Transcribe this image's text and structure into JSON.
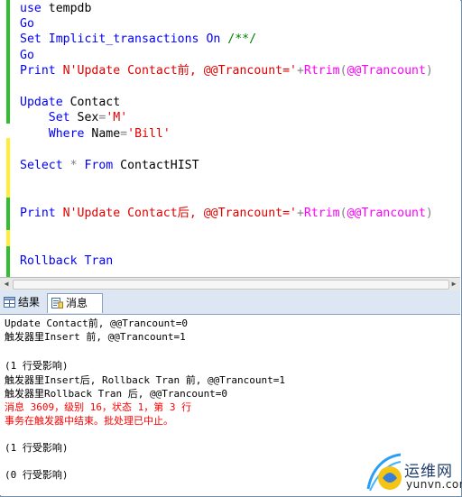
{
  "editor": {
    "lines": [
      {
        "segments": [
          {
            "t": "use ",
            "c": "kw"
          },
          {
            "t": "tempdb",
            "c": "id"
          }
        ]
      },
      {
        "segments": [
          {
            "t": "Go",
            "c": "kw"
          }
        ]
      },
      {
        "segments": [
          {
            "t": "Set ",
            "c": "kw"
          },
          {
            "t": "Implicit_transactions ",
            "c": "kw"
          },
          {
            "t": "On ",
            "c": "kw"
          },
          {
            "t": "/**/",
            "c": "cm"
          }
        ]
      },
      {
        "segments": [
          {
            "t": "Go",
            "c": "kw"
          }
        ]
      },
      {
        "segments": [
          {
            "t": "Print ",
            "c": "kw"
          },
          {
            "t": "N'Update Contact前, @@Trancount='",
            "c": "str"
          },
          {
            "t": "+",
            "c": "gray"
          },
          {
            "t": "Rtrim",
            "c": "sys"
          },
          {
            "t": "(",
            "c": "gray"
          },
          {
            "t": "@@Trancount",
            "c": "sys"
          },
          {
            "t": ")",
            "c": "gray"
          }
        ]
      },
      {
        "segments": []
      },
      {
        "segments": [
          {
            "t": "Update ",
            "c": "kw"
          },
          {
            "t": "Contact",
            "c": "id"
          }
        ]
      },
      {
        "segments": [
          {
            "t": "    Set ",
            "c": "kw"
          },
          {
            "t": "Sex",
            "c": "id"
          },
          {
            "t": "=",
            "c": "gray"
          },
          {
            "t": "'M'",
            "c": "str"
          }
        ]
      },
      {
        "segments": [
          {
            "t": "    Where ",
            "c": "kw"
          },
          {
            "t": "Name",
            "c": "id"
          },
          {
            "t": "=",
            "c": "gray"
          },
          {
            "t": "'Bill'",
            "c": "str"
          }
        ]
      },
      {
        "segments": []
      },
      {
        "segments": [
          {
            "t": "Select ",
            "c": "kw"
          },
          {
            "t": "* ",
            "c": "gray"
          },
          {
            "t": "From ",
            "c": "kw"
          },
          {
            "t": "ContactHIST",
            "c": "id"
          }
        ]
      },
      {
        "segments": []
      },
      {
        "segments": []
      },
      {
        "segments": [
          {
            "t": "Print ",
            "c": "kw"
          },
          {
            "t": "N'Update Contact后, @@Trancount='",
            "c": "str"
          },
          {
            "t": "+",
            "c": "gray"
          },
          {
            "t": "Rtrim",
            "c": "sys"
          },
          {
            "t": "(",
            "c": "gray"
          },
          {
            "t": "@@Trancount",
            "c": "sys"
          },
          {
            "t": ")",
            "c": "gray"
          }
        ]
      },
      {
        "segments": []
      },
      {
        "segments": []
      },
      {
        "segments": [
          {
            "t": "Rollback ",
            "c": "kw"
          },
          {
            "t": "Tran",
            "c": "kw"
          }
        ]
      }
    ]
  },
  "tabs": {
    "results_label": "结果",
    "messages_label": "消息"
  },
  "messages": {
    "lines": [
      {
        "text": "Update Contact前, @@Trancount=0",
        "color": "black"
      },
      {
        "text": "触发器里Insert 前, @@Trancount=1",
        "color": "black"
      },
      {
        "text": "",
        "color": "black"
      },
      {
        "text": "(1 行受影响)",
        "color": "black"
      },
      {
        "text": "触发器里Insert后, Rollback Tran 前, @@Trancount=1",
        "color": "black"
      },
      {
        "text": "触发器里Rollback Tran 后, @@Trancount=0",
        "color": "black"
      },
      {
        "text": "消息 3609，级别 16，状态 1，第 3 行",
        "color": "red"
      },
      {
        "text": "事务在触发器中结束。批处理已中止。",
        "color": "red"
      },
      {
        "text": "",
        "color": "black"
      },
      {
        "text": "(1 行受影响)",
        "color": "black"
      },
      {
        "text": "",
        "color": "black"
      },
      {
        "text": "(0 行受影响)",
        "color": "black"
      }
    ]
  },
  "watermark": {
    "title": "运维网",
    "url": "yunvn.com"
  },
  "colors": {
    "keyword": "#0000ff",
    "string": "#e00000",
    "system_function": "#ff00ff",
    "operator": "#808080",
    "comment": "#008000",
    "change_saved": "#2fbf2f",
    "change_unsaved": "#ffee33",
    "error": "#ff0000"
  }
}
